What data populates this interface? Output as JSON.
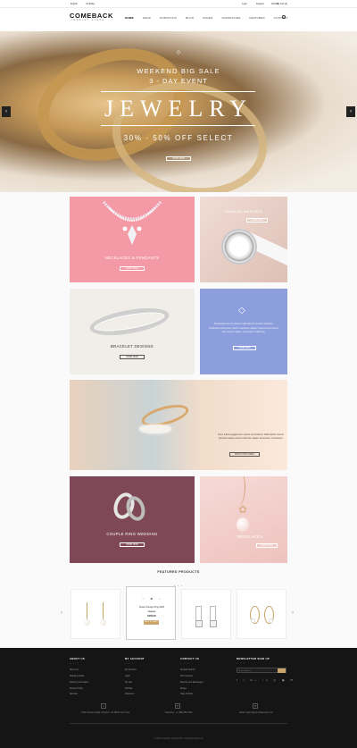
{
  "topbar": {
    "language": "English",
    "currency": "US Dollar",
    "links": [
      "Login",
      "Register",
      "Wishlist",
      "My Cart (0)"
    ]
  },
  "header": {
    "logo": "COMEBACK",
    "logo_sub": "JEWELRY STORE",
    "nav": [
      "HOME",
      "SHOP",
      "PORTFOLIO",
      "BLOG",
      "PAGES",
      "SHORTCODE",
      "FEATURES",
      "CONTACT"
    ]
  },
  "hero": {
    "line1": "WEEKEND BIG SALE",
    "line2": "3 - DAY EVENT",
    "line3": "JEWELRY",
    "line4": "30% - 50% OFF SELECT",
    "button": "SHOP NOW"
  },
  "tiles": {
    "necklaces": {
      "label": "NECKLACES & PENDANTS",
      "button": "SHOP NOW"
    },
    "watches": {
      "label": "FASHION WATCHES",
      "button": "SHOP NOW"
    },
    "bracelet": {
      "label": "BRACELET DESIGNS",
      "button": "SHOP NOW"
    },
    "promo": {
      "text": "Suspendisse ac ex eleifend nulla lobortis tincidunt; pharetra. Vestibulum ante ipsum primis in faucibus; aliquam viverra lorem ipsum erat; tempus sapien, consectetur adipiscing.",
      "button": "SHOP NOW"
    },
    "engagement": {
      "text": "Nunc tellus engagement; mauris nisi tincidunt. Nulla facilisi. Sed at pulvinar massa; viverra morbi elit, sapien accumsan, consectetur.",
      "button": "WATCH THE VIDEO"
    },
    "wedding": {
      "label": "COUPLE RING WEDDING",
      "button": "SHOP NOW"
    },
    "necklaces2": {
      "label": "NECKLACES",
      "button": "SHOP NOW"
    }
  },
  "featured": {
    "title": "FEATURED PRODUCTS",
    "product_name": "Flower Design Ring 2016",
    "price_old": "$189.00",
    "price": "$159.00",
    "add": "ADD TO CART"
  },
  "footer": {
    "cols": [
      {
        "title": "ABOUT US",
        "items": [
          "About Us",
          "Shipping Guide",
          "Delivery Information",
          "Privacy Policy",
          "Sitemap"
        ]
      },
      {
        "title": "MY ACCOUNT",
        "items": [
          "My Account",
          "Login",
          "My cart",
          "Wishlist",
          "Checkout"
        ]
      },
      {
        "title": "CONTACT US",
        "items": [
          "Product Search",
          "Gift Vouchers",
          "Returns and Exchanges",
          "Shops",
          "Help & FAQs"
        ]
      }
    ],
    "newsletter": {
      "title": "NEWSLETTER SIGN UP",
      "placeholder": "Email Address..."
    },
    "address": "1650 Chestnut Road, Hampton, VA 45200, New York",
    "phone": "Telephone: +1 (368) 563-7290",
    "email": "Email: support@comebackstore.com",
    "copyright": "© 2016 Comeback Jewelry Store. All Rights Reserved."
  }
}
